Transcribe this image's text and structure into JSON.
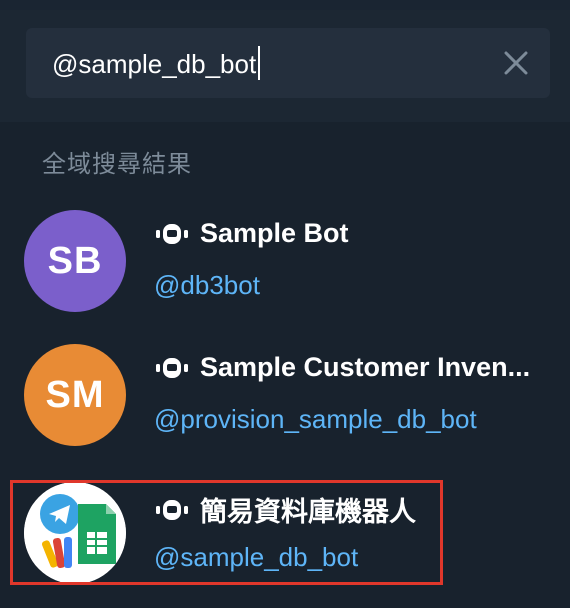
{
  "search": {
    "value": "@sample_db_bot",
    "clear_icon": "close-icon"
  },
  "section": {
    "title": "全域搜尋結果"
  },
  "results": [
    {
      "avatar_initials": "SB",
      "avatar_color": "#7b5fcb",
      "icon": "bot-icon",
      "name": "Sample Bot",
      "handle": "@db3bot"
    },
    {
      "avatar_initials": "SM",
      "avatar_color": "#e88b35",
      "icon": "bot-icon",
      "name": "Sample Customer Inven...",
      "handle": "@provision_sample_db_bot"
    },
    {
      "avatar_initials": "",
      "avatar_icon": "telegram-sheets-logo",
      "icon": "bot-icon",
      "name": "簡易資料庫機器人",
      "handle": "@sample_db_bot",
      "highlighted": true
    }
  ],
  "colors": {
    "background": "#18222d",
    "search_box": "#242f3d",
    "link": "#5eb5f7",
    "highlight": "#e0372b"
  }
}
